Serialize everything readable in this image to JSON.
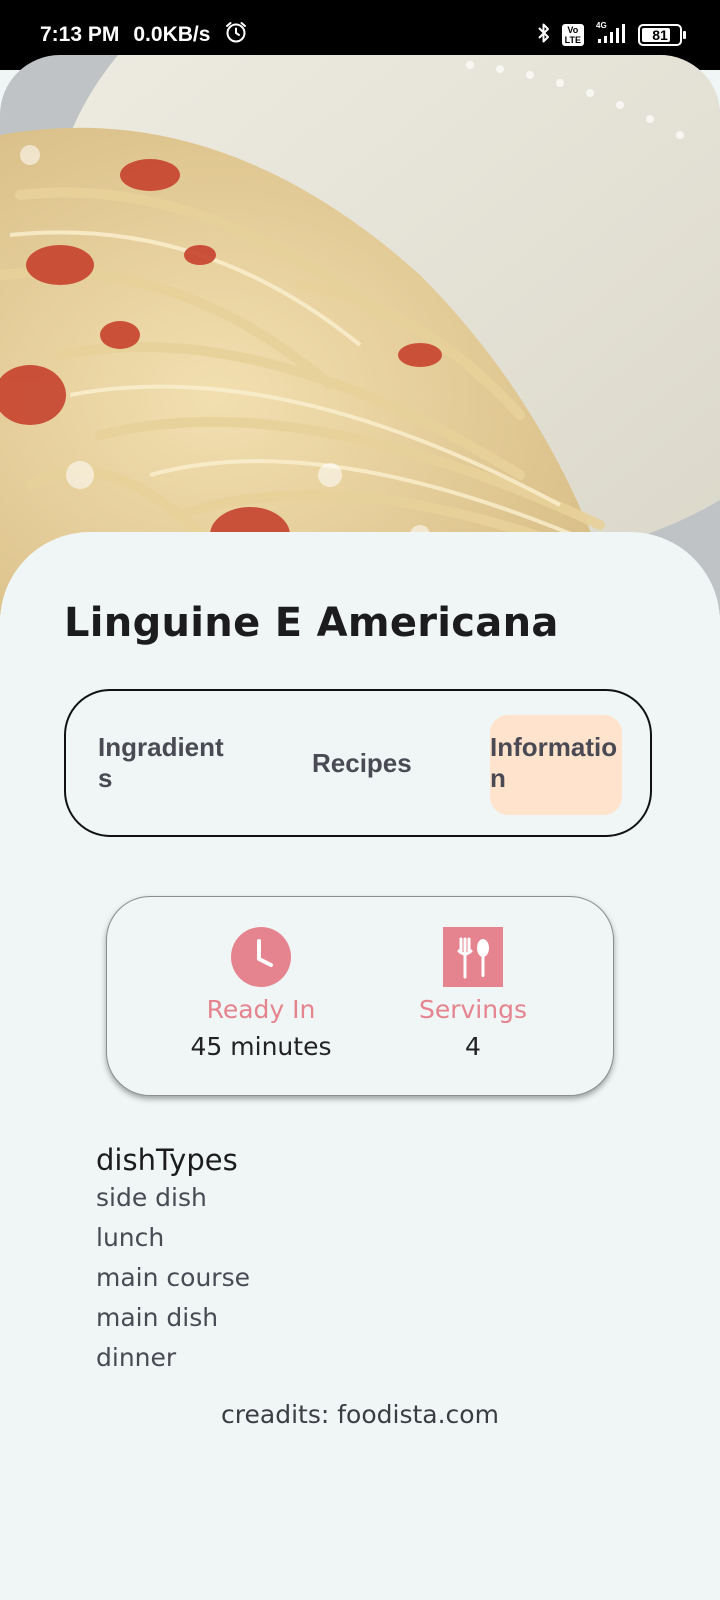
{
  "status_bar": {
    "time": "7:13 PM",
    "speed": "0.0KB/s",
    "volte_label": "Vo LTE",
    "network_label": "4G",
    "battery_level": "81",
    "icons": [
      "alarm-icon",
      "bluetooth-icon",
      "volte-icon",
      "signal-icon",
      "battery-icon"
    ]
  },
  "hero": {
    "image": "pasta-photo"
  },
  "recipe": {
    "title": "Linguine E Americana"
  },
  "tabs": {
    "items": [
      {
        "label": "Ingradients"
      },
      {
        "label": "Recipes"
      },
      {
        "label": "Information"
      }
    ],
    "active_index": 2
  },
  "info_card": {
    "ready_label": "Ready In",
    "ready_value": "45 minutes",
    "servings_label": "Servings",
    "servings_value": "4",
    "icons": [
      "clock-icon",
      "cutlery-icon"
    ]
  },
  "dish_types": {
    "heading": "dishTypes",
    "items": [
      "side dish",
      "lunch",
      "main course",
      "main dish",
      "dinner"
    ]
  },
  "credits": "creadits: foodista.com",
  "colors": {
    "accent": "#e5838f",
    "active_tab": "#ffe3cc",
    "background": "#eff6f5"
  }
}
